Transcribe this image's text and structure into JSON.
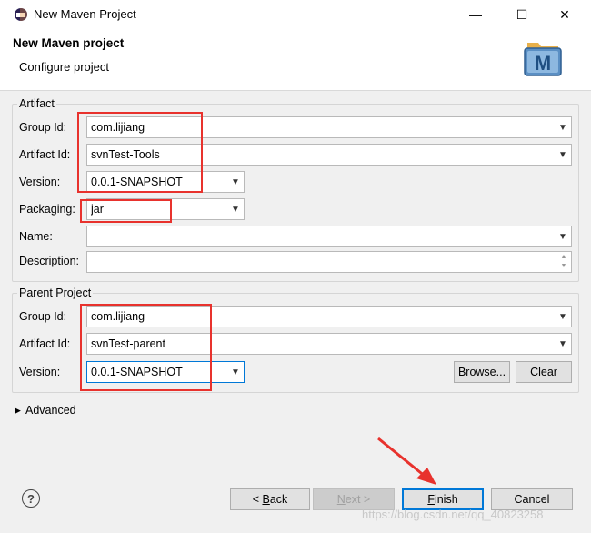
{
  "window": {
    "title": "New Maven Project",
    "minimize": "—",
    "maximize": "☐",
    "close": "✕"
  },
  "header": {
    "title": "New Maven project",
    "subtitle": "Configure project",
    "logo_letter": "M"
  },
  "artifact": {
    "group_label": "Artifact",
    "group_id_label": "Group Id:",
    "group_id_value": "com.lijiang",
    "artifact_id_label": "Artifact Id:",
    "artifact_id_value": "svnTest-Tools",
    "version_label": "Version:",
    "version_value": "0.0.1-SNAPSHOT",
    "packaging_label": "Packaging:",
    "packaging_value": "jar",
    "name_label": "Name:",
    "name_value": "",
    "description_label": "Description:",
    "description_value": ""
  },
  "parent": {
    "group_label": "Parent Project",
    "group_id_label": "Group Id:",
    "group_id_value": "com.lijiang",
    "artifact_id_label": "Artifact Id:",
    "artifact_id_value": "svnTest-parent",
    "version_label": "Version:",
    "version_value": "0.0.1-SNAPSHOT",
    "browse_label": "Browse...",
    "clear_label": "Clear"
  },
  "advanced": {
    "label": "Advanced"
  },
  "footer": {
    "help": "?",
    "back_mnemonic": "B",
    "back_prefix": "< ",
    "back_rest": "ack",
    "next_mnemonic": "N",
    "next_rest": "ext >",
    "finish_mnemonic": "F",
    "finish_rest": "inish",
    "cancel_label": "Cancel"
  },
  "watermark": "https://blog.csdn.net/qq_40823258",
  "colors": {
    "annotation_red": "#e8322d",
    "focus_blue": "#0078d7"
  }
}
